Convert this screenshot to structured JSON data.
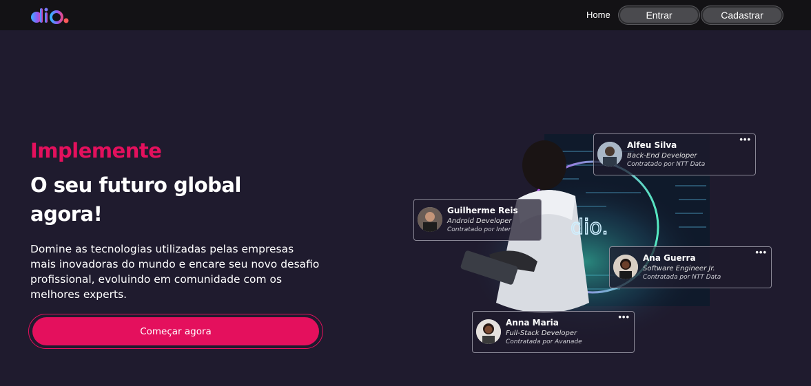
{
  "header": {
    "logo_alt": "dio.",
    "nav": {
      "home_label": "Home",
      "entrar_label": "Entrar",
      "cadastrar_label": "Cadastrar"
    }
  },
  "hero": {
    "title_highlight": "Implemente",
    "title_main": "O seu futuro global agora!",
    "subtitle": "Domine as tecnologias utilizadas pelas empresas mais inovadoras do mundo e encare seu novo desafio profissional, evoluindo em comunidade com os melhores experts.",
    "cta_label": "Começar agora"
  },
  "cards": [
    {
      "name": "Alfeu Silva",
      "role": "Back-End Developer",
      "company": "Contratado por NTT Data",
      "more_label": "•••"
    },
    {
      "name": "Guilherme Reis",
      "role": "Android Developer",
      "company": "Contratado por Inter",
      "more_label": ""
    },
    {
      "name": "Ana Guerra",
      "role": "Software Engineer Jr.",
      "company": "Contratada por NTT Data",
      "more_label": "•••"
    },
    {
      "name": "Anna Maria",
      "role": "Full-Stack Developer",
      "company": "Contratada por Avanade",
      "more_label": "•••"
    }
  ],
  "colors": {
    "background": "#1f1b2e",
    "header": "#131215",
    "accent": "#e4105d"
  }
}
